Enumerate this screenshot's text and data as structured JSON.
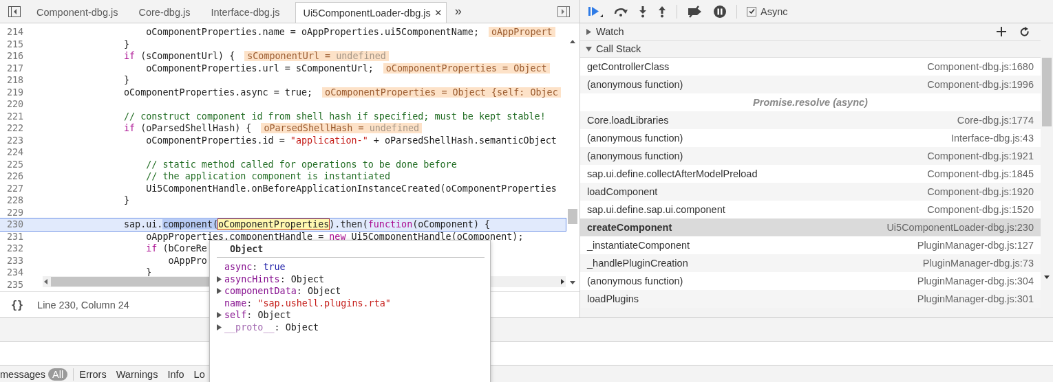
{
  "editor": {
    "tabs": [
      {
        "label": "Component-dbg.js",
        "selected": false
      },
      {
        "label": "Core-dbg.js",
        "selected": false
      },
      {
        "label": "Interface-dbg.js",
        "selected": false
      },
      {
        "label": "Ui5ComponentLoader-dbg.js",
        "selected": true
      }
    ],
    "close": "×",
    "more": "»",
    "lines": [
      {
        "number": "214",
        "current": false,
        "tokens": [
          {
            "text": "                    oComponentProperties.name = oAppProperties.ui5ComponentName;",
            "kind": "plain"
          }
        ],
        "hint": [
          {
            "text": "oAppPropert",
            "kind": "name"
          }
        ]
      },
      {
        "number": "215",
        "current": false,
        "tokens": [
          {
            "text": "                }",
            "kind": "plain"
          }
        ]
      },
      {
        "number": "216",
        "current": false,
        "tokens": [
          {
            "text": "                if",
            "kind": "keyword"
          },
          {
            "text": " (sComponentUrl) {",
            "kind": "plain"
          }
        ],
        "hint": [
          {
            "text": "sComponentUrl = ",
            "kind": "name"
          },
          {
            "text": "undefined",
            "kind": "undefined"
          }
        ]
      },
      {
        "number": "217",
        "current": false,
        "tokens": [
          {
            "text": "                    oComponentProperties.url = sComponentUrl;",
            "kind": "plain"
          }
        ],
        "hint": [
          {
            "text": "oComponentProperties = Object",
            "kind": "name"
          }
        ]
      },
      {
        "number": "218",
        "current": false,
        "tokens": [
          {
            "text": "                }",
            "kind": "plain"
          }
        ]
      },
      {
        "number": "219",
        "current": false,
        "tokens": [
          {
            "text": "                oComponentProperties.async = true;",
            "kind": "plain"
          }
        ],
        "hint": [
          {
            "text": "oComponentProperties = Object {self: Objec",
            "kind": "name"
          }
        ]
      },
      {
        "number": "220",
        "current": false
      },
      {
        "number": "221",
        "current": false,
        "tokens": [
          {
            "text": "                // construct component id from shell hash if specified; must be kept stable!",
            "kind": "comment"
          }
        ]
      },
      {
        "number": "222",
        "current": false,
        "tokens": [
          {
            "text": "                if",
            "kind": "keyword"
          },
          {
            "text": " (oParsedShellHash) {",
            "kind": "plain"
          }
        ],
        "hint": [
          {
            "text": "oParsedShellHash = ",
            "kind": "name"
          },
          {
            "text": "undefined",
            "kind": "undefined"
          }
        ]
      },
      {
        "number": "223",
        "current": false,
        "tokens": [
          {
            "text": "                    oComponentProperties.id = ",
            "kind": "plain"
          },
          {
            "text": "\"application-\"",
            "kind": "string"
          },
          {
            "text": " + oParsedShellHash.semanticObject",
            "kind": "plain"
          }
        ]
      },
      {
        "number": "224",
        "current": false
      },
      {
        "number": "225",
        "current": false,
        "tokens": [
          {
            "text": "                    // static method called for operations to be done before",
            "kind": "comment"
          }
        ]
      },
      {
        "number": "226",
        "current": false,
        "tokens": [
          {
            "text": "                    // the application component is instantiated",
            "kind": "comment"
          }
        ]
      },
      {
        "number": "227",
        "current": false,
        "tokens": [
          {
            "text": "                    Ui5ComponentHandle.onBeforeApplicationInstanceCreated(oComponentProperties",
            "kind": "plain"
          }
        ]
      },
      {
        "number": "228",
        "current": false,
        "tokens": [
          {
            "text": "                }",
            "kind": "plain"
          }
        ]
      },
      {
        "number": "229",
        "current": false
      },
      {
        "number": "230",
        "current": true,
        "tokens": [
          {
            "text": "                sap.ui.",
            "kind": "plain"
          },
          {
            "text": "component(",
            "kind": "selected"
          },
          {
            "text": "oComponentProperties",
            "kind": "hovered"
          },
          {
            "text": ").then(",
            "kind": "plain"
          },
          {
            "text": "function",
            "kind": "keyword"
          },
          {
            "text": "(oComponent) {",
            "kind": "plain"
          }
        ]
      },
      {
        "number": "231",
        "current": false,
        "tokens": [
          {
            "text": "                    oAppProperties.componentHandle = ",
            "kind": "plain"
          },
          {
            "text": "new",
            "kind": "keyword"
          },
          {
            "text": " Ui5ComponentHandle(oComponent);",
            "kind": "plain"
          }
        ]
      },
      {
        "number": "232",
        "current": false,
        "tokens": [
          {
            "text": "                    if",
            "kind": "keyword"
          },
          {
            "text": " (bCoreRe",
            "kind": "plain"
          }
        ]
      },
      {
        "number": "233",
        "current": false,
        "tokens": [
          {
            "text": "                        oAppPro",
            "kind": "plain"
          }
        ]
      },
      {
        "number": "234",
        "current": false,
        "tokens": [
          {
            "text": "                    }",
            "kind": "plain"
          }
        ]
      },
      {
        "number": "235",
        "current": false
      }
    ],
    "status": {
      "format": "{}",
      "position": "Line 230, Column 24"
    }
  },
  "popover": {
    "title": "Object",
    "separator": ":",
    "properties": [
      {
        "name": "async",
        "value": "true",
        "kind": "boolean",
        "expandable": false
      },
      {
        "name": "asyncHints",
        "value": "Object",
        "kind": "object",
        "expandable": true
      },
      {
        "name": "componentData",
        "value": "Object",
        "kind": "object",
        "expandable": true
      },
      {
        "name": "name",
        "value": "\"sap.ushell.plugins.rta\"",
        "kind": "string",
        "expandable": false
      },
      {
        "name": "self",
        "value": "Object",
        "kind": "object",
        "expandable": true
      },
      {
        "name": "__proto__",
        "value": "Object",
        "kind": "internal",
        "expandable": true
      }
    ]
  },
  "debugger": {
    "async": {
      "label": "Async",
      "checked": true
    },
    "watch": {
      "title": "Watch",
      "expanded": false
    },
    "call_stack": {
      "title": "Call Stack",
      "expanded": true,
      "frames": [
        {
          "kind": "frame",
          "function": "getControllerClass",
          "location": "Component-dbg.js:1680",
          "selected": false
        },
        {
          "kind": "frame",
          "function": "(anonymous function)",
          "location": "Component-dbg.js:1996",
          "selected": false
        },
        {
          "kind": "async",
          "label": "Promise.resolve (async)",
          "selected": false
        },
        {
          "kind": "frame",
          "function": "Core.loadLibraries",
          "location": "Core-dbg.js:1774",
          "selected": false
        },
        {
          "kind": "frame",
          "function": "(anonymous function)",
          "location": "Interface-dbg.js:43",
          "selected": false
        },
        {
          "kind": "frame",
          "function": "(anonymous function)",
          "location": "Component-dbg.js:1921",
          "selected": false
        },
        {
          "kind": "frame",
          "function": "sap.ui.define.collectAfterModelPreload",
          "location": "Component-dbg.js:1845",
          "selected": false
        },
        {
          "kind": "frame",
          "function": "loadComponent",
          "location": "Component-dbg.js:1920",
          "selected": false
        },
        {
          "kind": "frame",
          "function": "sap.ui.define.sap.ui.component",
          "location": "Component-dbg.js:1520",
          "selected": false
        },
        {
          "kind": "frame",
          "function": "createComponent",
          "location": "Ui5ComponentLoader-dbg.js:230",
          "selected": true
        },
        {
          "kind": "frame",
          "function": "_instantiateComponent",
          "location": "PluginManager-dbg.js:127",
          "selected": false
        },
        {
          "kind": "frame",
          "function": "_handlePluginCreation",
          "location": "PluginManager-dbg.js:73",
          "selected": false
        },
        {
          "kind": "frame",
          "function": "(anonymous function)",
          "location": "PluginManager-dbg.js:304",
          "selected": false
        },
        {
          "kind": "frame",
          "function": "loadPlugins",
          "location": "PluginManager-dbg.js:301",
          "selected": false
        }
      ]
    }
  },
  "console": {
    "filters": [
      {
        "label": "messages",
        "selected": false
      },
      {
        "label": "All",
        "selected": true
      },
      {
        "label": "Errors",
        "selected": false
      },
      {
        "label": "Warnings",
        "selected": false
      },
      {
        "label": "Info",
        "selected": false
      },
      {
        "label": "Lo",
        "selected": false
      }
    ]
  }
}
